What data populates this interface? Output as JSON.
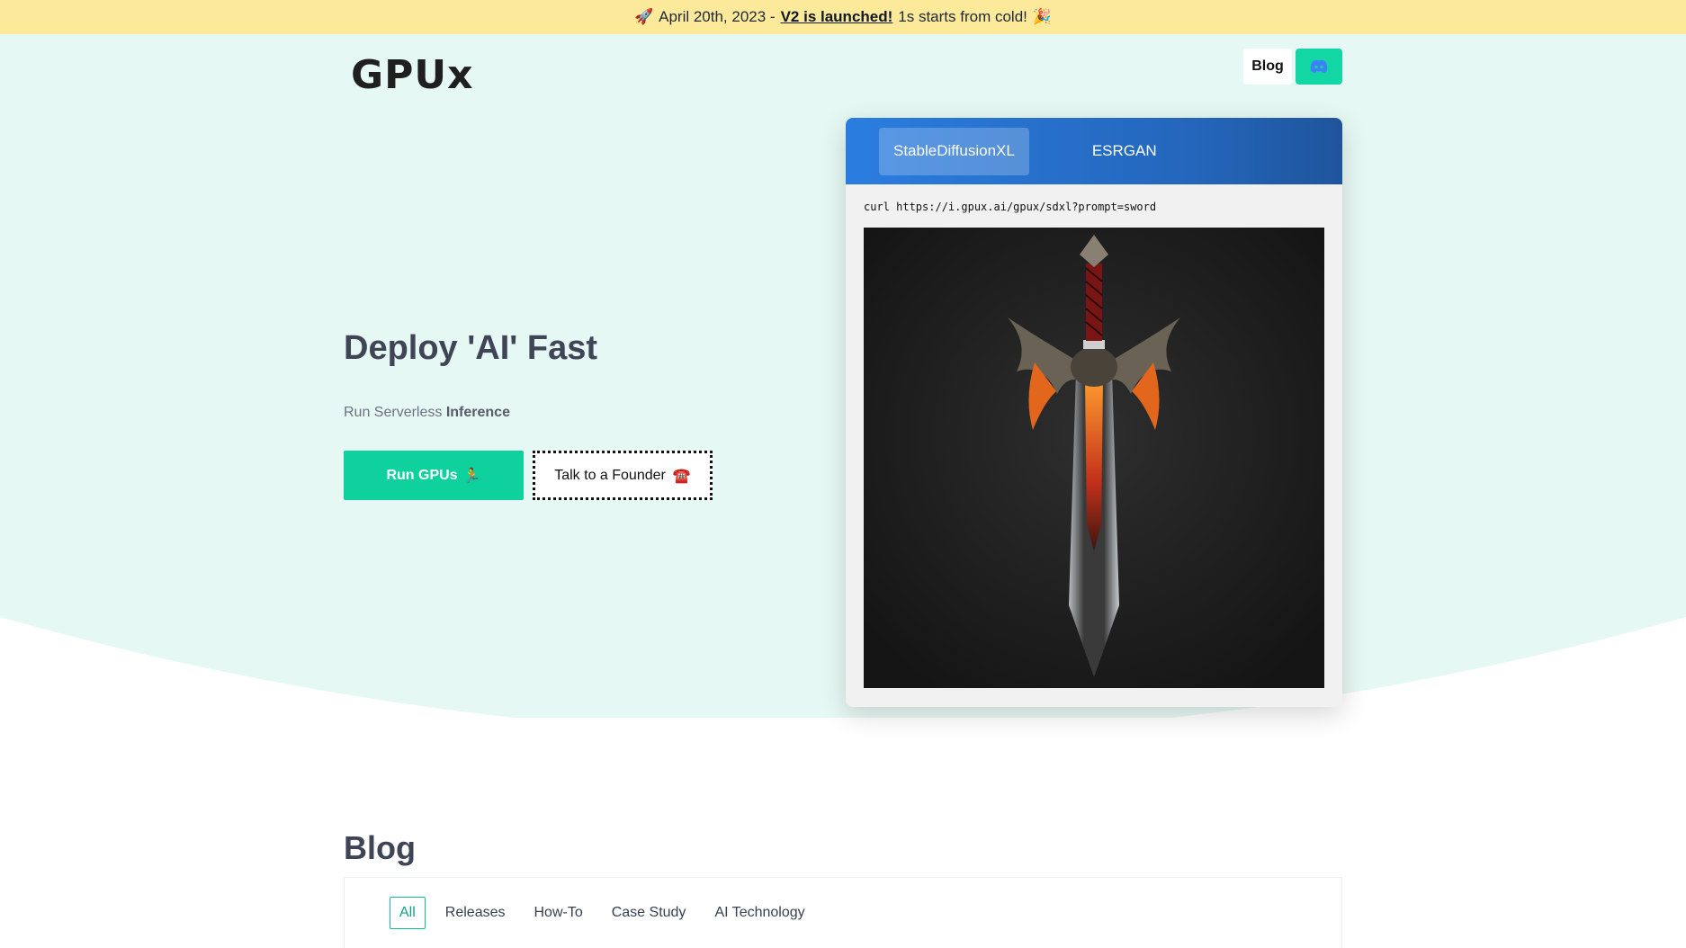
{
  "announcement": {
    "rocket_emoji": "🚀",
    "date_prefix": "April 20th, 2023 -",
    "link_text": "V2 is launched!",
    "suffix": "1s starts from cold!",
    "party_emoji": "🎉"
  },
  "nav": {
    "logo_text": "GPUx",
    "blog_label": "Blog",
    "discord_icon": "discord-icon"
  },
  "hero": {
    "title": "Deploy 'AI' Fast",
    "subtitle_plain": "Run Serverless",
    "subtitle_bold": "Inference",
    "primary_button": "Run GPUs",
    "primary_emoji": "🏃",
    "secondary_button": "Talk to a Founder",
    "secondary_emoji": "☎️"
  },
  "demo_card": {
    "tabs": [
      {
        "label": "StableDiffusionXL",
        "active": true
      },
      {
        "label": "ESRGAN",
        "active": false
      }
    ],
    "command": "curl https://i.gpux.ai/gpux/sdxl?prompt=sword",
    "image_subject": "sword"
  },
  "blog": {
    "title": "Blog",
    "filters": [
      {
        "label": "All",
        "active": true
      },
      {
        "label": "Releases",
        "active": false
      },
      {
        "label": "How-To",
        "active": false
      },
      {
        "label": "Case Study",
        "active": false
      },
      {
        "label": "AI Technology",
        "active": false
      }
    ]
  },
  "colors": {
    "accent": "#0fd19e",
    "announcement_bg": "#fce99a",
    "hero_bg": "#e6f8f3",
    "tab_bar": "#2a7de0"
  }
}
